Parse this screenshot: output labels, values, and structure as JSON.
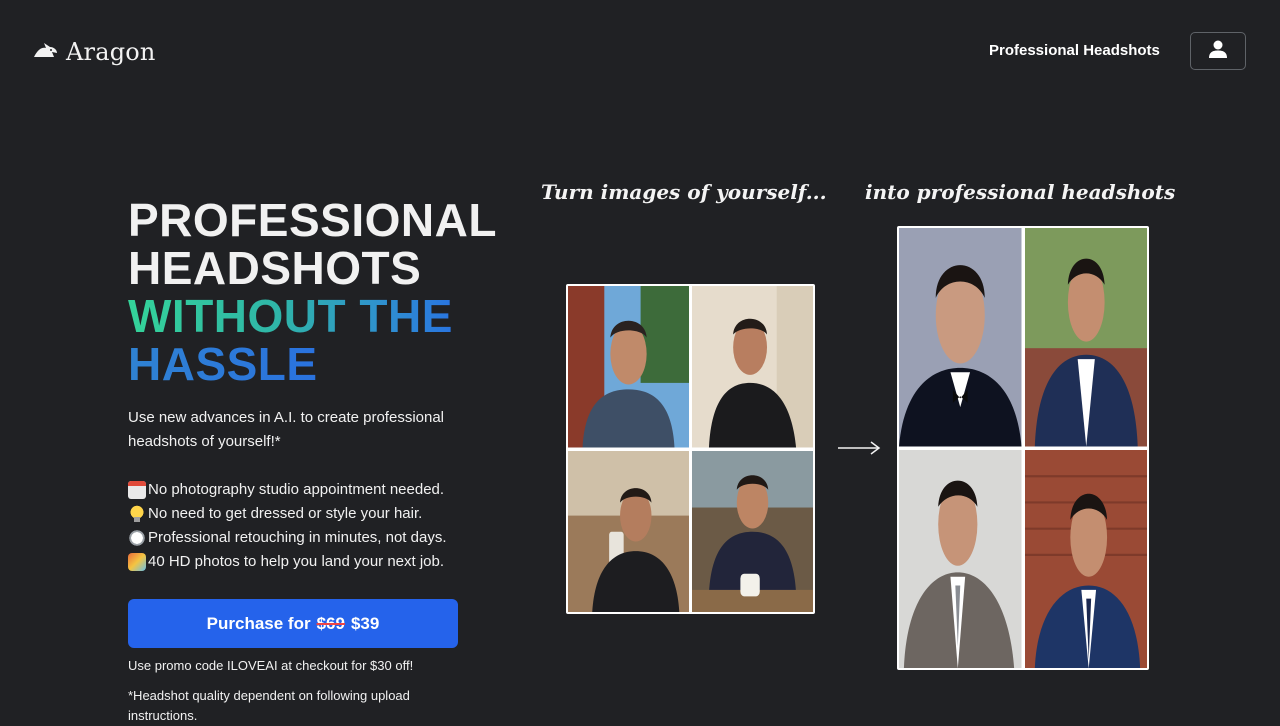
{
  "header": {
    "brand": "Aragon",
    "nav_link": "Professional Headshots"
  },
  "hero": {
    "headline_line1": "PROFESSIONAL",
    "headline_line2": "HEADSHOTS",
    "headline_line3": "WITHOUT THE",
    "headline_line4": "HASSLE",
    "subtitle": "Use new advances in A.I. to create professional headshots of yourself!*",
    "features": [
      {
        "icon": "calendar-icon",
        "text": "No photography studio appointment needed."
      },
      {
        "icon": "lightbulb-icon",
        "text": "No need to get dressed or style your hair."
      },
      {
        "icon": "stopwatch-icon",
        "text": "Professional retouching in minutes, not days."
      },
      {
        "icon": "party-icon",
        "text": "40 HD photos to help you land your next job."
      }
    ],
    "cta": {
      "prefix": "Purchase for",
      "old_price": "$69",
      "new_price": "$39"
    },
    "promo": "Use promo code ILOVEAI at checkout for $30 off!",
    "disclaimer": "*Headshot quality dependent on following upload instructions."
  },
  "showcase": {
    "caption_before": "Turn images of yourself...",
    "caption_after": "into professional headshots"
  },
  "colors": {
    "background": "#202124",
    "accent": "#2563eb",
    "gradient_start": "#34d399",
    "gradient_end": "#2563eb"
  }
}
